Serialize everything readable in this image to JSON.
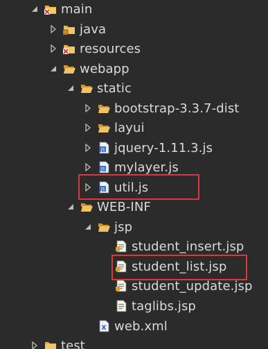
{
  "tree": {
    "nodes": [
      {
        "label": "main",
        "icon": "source-folder-error-icon",
        "twisty": "expanded"
      },
      {
        "label": "java",
        "icon": "package-folder-icon",
        "twisty": "collapsed"
      },
      {
        "label": "resources",
        "icon": "source-folder-error-icon",
        "twisty": "collapsed"
      },
      {
        "label": "webapp",
        "icon": "folder-open-icon",
        "twisty": "expanded"
      },
      {
        "label": "static",
        "icon": "folder-open-icon",
        "twisty": "expanded"
      },
      {
        "label": "bootstrap-3.3.7-dist",
        "icon": "folder-icon",
        "twisty": "collapsed"
      },
      {
        "label": "layui",
        "icon": "folder-icon",
        "twisty": "collapsed"
      },
      {
        "label": "jquery-1.11.3.js",
        "icon": "js-file-icon",
        "twisty": "collapsed"
      },
      {
        "label": "mylayer.js",
        "icon": "js-file-icon",
        "twisty": "collapsed"
      },
      {
        "label": "util.js",
        "icon": "js-file-icon",
        "twisty": "collapsed"
      },
      {
        "label": "WEB-INF",
        "icon": "folder-open-icon",
        "twisty": "expanded"
      },
      {
        "label": "jsp",
        "icon": "folder-open-icon",
        "twisty": "expanded"
      },
      {
        "label": "student_insert.jsp",
        "icon": "jsp-file-icon",
        "twisty": "none"
      },
      {
        "label": "student_list.jsp",
        "icon": "jsp-file-icon",
        "twisty": "none"
      },
      {
        "label": "student_update.jsp",
        "icon": "jsp-file-icon",
        "twisty": "none"
      },
      {
        "label": "taglibs.jsp",
        "icon": "jsp-file-icon",
        "twisty": "none"
      },
      {
        "label": "web.xml",
        "icon": "xml-file-icon",
        "twisty": "none"
      },
      {
        "label": "test",
        "icon": "folder-icon",
        "twisty": "collapsed"
      }
    ],
    "highlighted": [
      "util.js",
      "student_list.jsp"
    ]
  },
  "colors": {
    "background": "#2b2b2b",
    "text": "#dadada",
    "highlight_border": "#e0363a",
    "folder": "#e8b04a",
    "error_badge": "#d9382e"
  }
}
